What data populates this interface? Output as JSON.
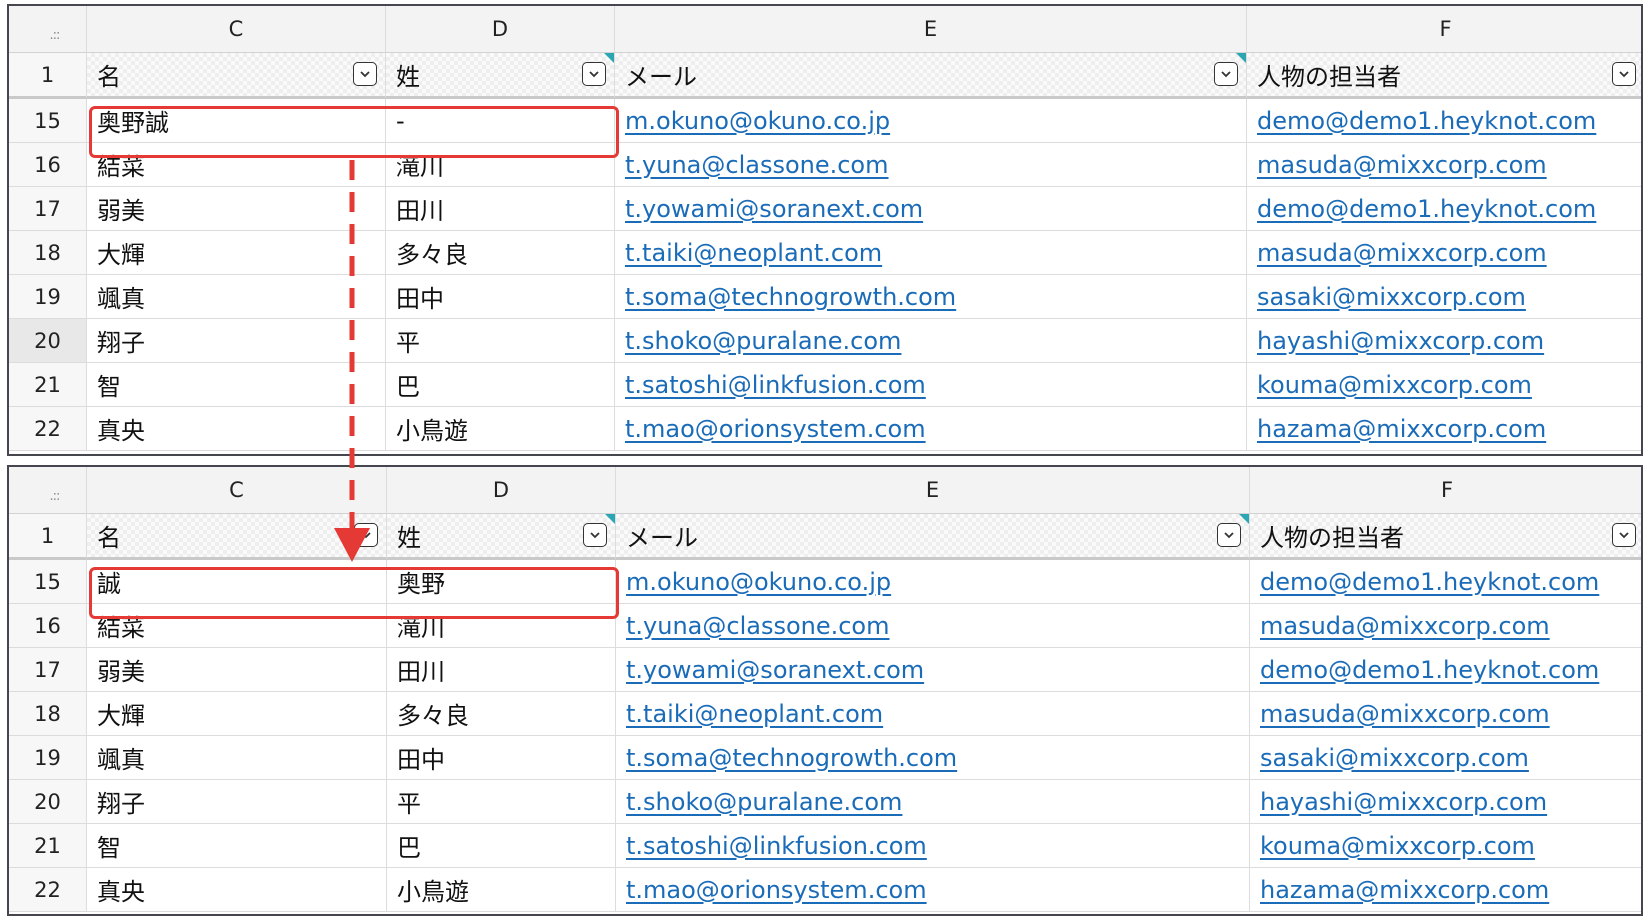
{
  "columns": [
    "C",
    "D",
    "E",
    "F"
  ],
  "headers": [
    "名",
    "姓",
    "メール",
    "人物の担当者"
  ],
  "before": {
    "rows": [
      {
        "num": "15",
        "first": "奥野誠",
        "last": "-",
        "email": "m.okuno@okuno.co.jp",
        "owner": "demo@demo1.heyknot.com"
      },
      {
        "num": "16",
        "first": "結菜",
        "last": "滝川",
        "email": "t.yuna@classone.com",
        "owner": "masuda@mixxcorp.com"
      },
      {
        "num": "17",
        "first": "弱美",
        "last": "田川",
        "email": "t.yowami@soranext.com",
        "owner": "demo@demo1.heyknot.com"
      },
      {
        "num": "18",
        "first": "大輝",
        "last": "多々良",
        "email": "t.taiki@neoplant.com",
        "owner": "masuda@mixxcorp.com"
      },
      {
        "num": "19",
        "first": "颯真",
        "last": "田中",
        "email": "t.soma@technogrowth.com",
        "owner": "sasaki@mixxcorp.com"
      },
      {
        "num": "20",
        "first": "翔子",
        "last": "平",
        "email": "t.shoko@puralane.com",
        "owner": "hayashi@mixxcorp.com"
      },
      {
        "num": "21",
        "first": "智",
        "last": "巴",
        "email": "t.satoshi@linkfusion.com",
        "owner": "kouma@mixxcorp.com"
      },
      {
        "num": "22",
        "first": "真央",
        "last": "小鳥遊",
        "email": "t.mao@orionsystem.com",
        "owner": "hazama@mixxcorp.com"
      }
    ]
  },
  "after": {
    "rows": [
      {
        "num": "15",
        "first": "誠",
        "last": "奥野",
        "email": "m.okuno@okuno.co.jp",
        "owner": "demo@demo1.heyknot.com"
      },
      {
        "num": "16",
        "first": "結菜",
        "last": "滝川",
        "email": "t.yuna@classone.com",
        "owner": "masuda@mixxcorp.com"
      },
      {
        "num": "17",
        "first": "弱美",
        "last": "田川",
        "email": "t.yowami@soranext.com",
        "owner": "demo@demo1.heyknot.com"
      },
      {
        "num": "18",
        "first": "大輝",
        "last": "多々良",
        "email": "t.taiki@neoplant.com",
        "owner": "masuda@mixxcorp.com"
      },
      {
        "num": "19",
        "first": "颯真",
        "last": "田中",
        "email": "t.soma@technogrowth.com",
        "owner": "sasaki@mixxcorp.com"
      },
      {
        "num": "20",
        "first": "翔子",
        "last": "平",
        "email": "t.shoko@puralane.com",
        "owner": "hayashi@mixxcorp.com"
      },
      {
        "num": "21",
        "first": "智",
        "last": "巴",
        "email": "t.satoshi@linkfusion.com",
        "owner": "kouma@mixxcorp.com"
      },
      {
        "num": "22",
        "first": "真央",
        "last": "小鳥遊",
        "email": "t.mao@orionsystem.com",
        "owner": "hazama@mixxcorp.com"
      }
    ]
  },
  "colors": {
    "highlight": "#e53935",
    "link": "#1a6bb8",
    "note_marker": "#2aa7b3"
  },
  "icons": {
    "filter": "chevron-down-icon",
    "corner": "select-all-icon"
  }
}
